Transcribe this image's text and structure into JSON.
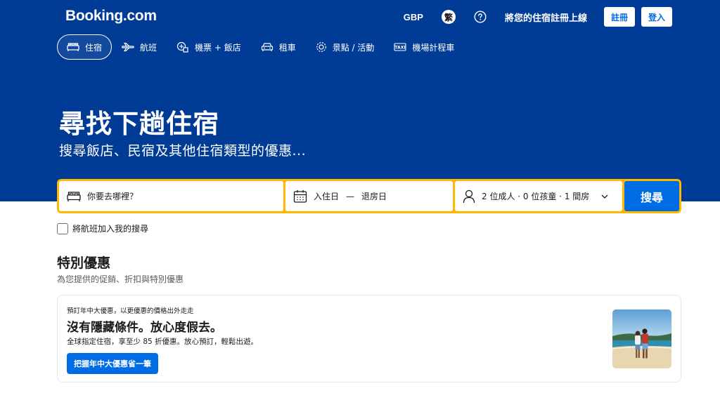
{
  "brand": {
    "name": "Booking.com"
  },
  "header": {
    "currency": "GBP",
    "language": "繁",
    "help_icon": "question-circle-icon",
    "list_property": "將您的住宿註冊上線",
    "register": "註冊",
    "sign_in": "登入"
  },
  "nav": {
    "items": [
      {
        "label": "住宿",
        "icon": "bed-icon",
        "active": true
      },
      {
        "label": "航班",
        "icon": "plane-icon",
        "active": false
      },
      {
        "label": "機票 + 飯店",
        "icon": "flight-hotel-icon",
        "active": false
      },
      {
        "label": "租車",
        "icon": "car-icon",
        "active": false
      },
      {
        "label": "景點 / 活動",
        "icon": "attractions-icon",
        "active": false
      },
      {
        "label": "機場計程車",
        "icon": "taxi-icon",
        "active": false
      }
    ]
  },
  "hero": {
    "title": "尋找下趟住宿",
    "subtitle": "搜尋飯店、民宿及其他住宿類型的優惠..."
  },
  "search": {
    "destination_placeholder": "你要去哪裡？",
    "checkin": "入住日",
    "dash": "—",
    "checkout": "退房日",
    "guests": "2 位成人 · 0 位孩童 · 1 間房",
    "button": "搜尋",
    "add_flight": "將航班加入我的搜尋"
  },
  "offers": {
    "title": "特別優惠",
    "subtitle": "為您提供的促銷、折扣與特別優惠",
    "card": {
      "kicker": "預訂年中大優惠，以更優惠的價格出外走走",
      "title": "沒有隱藏條件。放心度假去。",
      "description": "全球指定住宿，享至少 85 折優惠。放心預訂，輕鬆出遊。",
      "cta": "把握年中大優惠省一筆"
    }
  },
  "colors": {
    "brand_blue": "#003b95",
    "action_blue": "#006ce4",
    "search_border": "#ffb700"
  }
}
